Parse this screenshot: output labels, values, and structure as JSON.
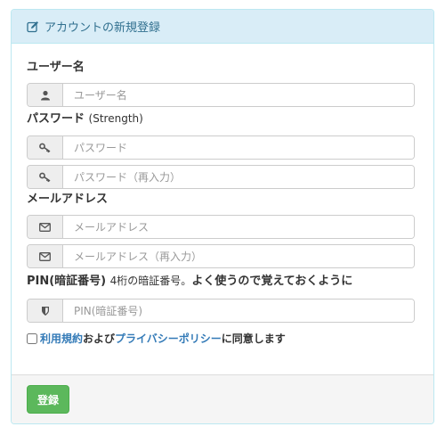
{
  "heading": {
    "icon": "edit-icon",
    "title": "アカウントの新規登録"
  },
  "username": {
    "label": "ユーザー名",
    "icon": "user-icon",
    "placeholder": "ユーザー名"
  },
  "password": {
    "label": "パスワード",
    "label_sub": "(Strength)",
    "icon": "key-icon",
    "placeholder": "パスワード",
    "confirm_placeholder": "パスワード（再入力）"
  },
  "email": {
    "label": "メールアドレス",
    "icon": "envelope-icon",
    "placeholder": "メールアドレス",
    "confirm_placeholder": "メールアドレス（再入力）"
  },
  "pin": {
    "label": "PIN(暗証番号)",
    "hint_pre": "4桁の暗証番号。",
    "hint_bold": "よく使うので覚えておくように",
    "icon": "shield-icon",
    "placeholder": "PIN(暗証番号)"
  },
  "terms": {
    "checked": false,
    "link1": "利用規約",
    "text1": "および",
    "link2": "プライバシーポリシー",
    "text2": "に同意します"
  },
  "footer": {
    "submit_label": "登録"
  },
  "colors": {
    "heading_bg": "#d9edf7",
    "heading_text": "#31708f",
    "panel_border": "#bce8f1",
    "link": "#337ab7",
    "button": "#5cb85c"
  }
}
